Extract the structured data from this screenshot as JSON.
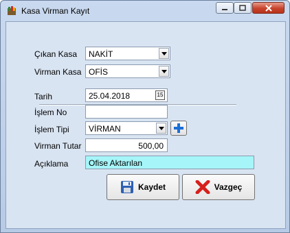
{
  "window": {
    "title": "Kasa Virman Kayıt"
  },
  "form": {
    "cikan_kasa": {
      "label": "Çıkan Kasa",
      "value": "NAKİT"
    },
    "virman_kasa": {
      "label": "Virman Kasa",
      "value": "OFİS"
    },
    "tarih": {
      "label": "Tarih",
      "value": "25.04.2018",
      "calendar_icon_text": "15"
    },
    "islem_no": {
      "label": "İşlem No",
      "value": ""
    },
    "islem_tipi": {
      "label": "İşlem Tipi",
      "value": "VİRMAN"
    },
    "virman_tutar": {
      "label": "Virman Tutar",
      "value": "500,00"
    },
    "aciklama": {
      "label": "Açıklama",
      "value": "Ofise Aktarılan",
      "bg_color": "#a6f5f8"
    }
  },
  "buttons": {
    "save": "Kaydet",
    "cancel": "Vazgeç"
  },
  "icons": [
    "app-icon",
    "minimize-icon",
    "maximize-icon",
    "close-icon",
    "chevron-down-icon",
    "calendar-icon",
    "plus-icon",
    "save-icon",
    "cancel-x-icon"
  ]
}
